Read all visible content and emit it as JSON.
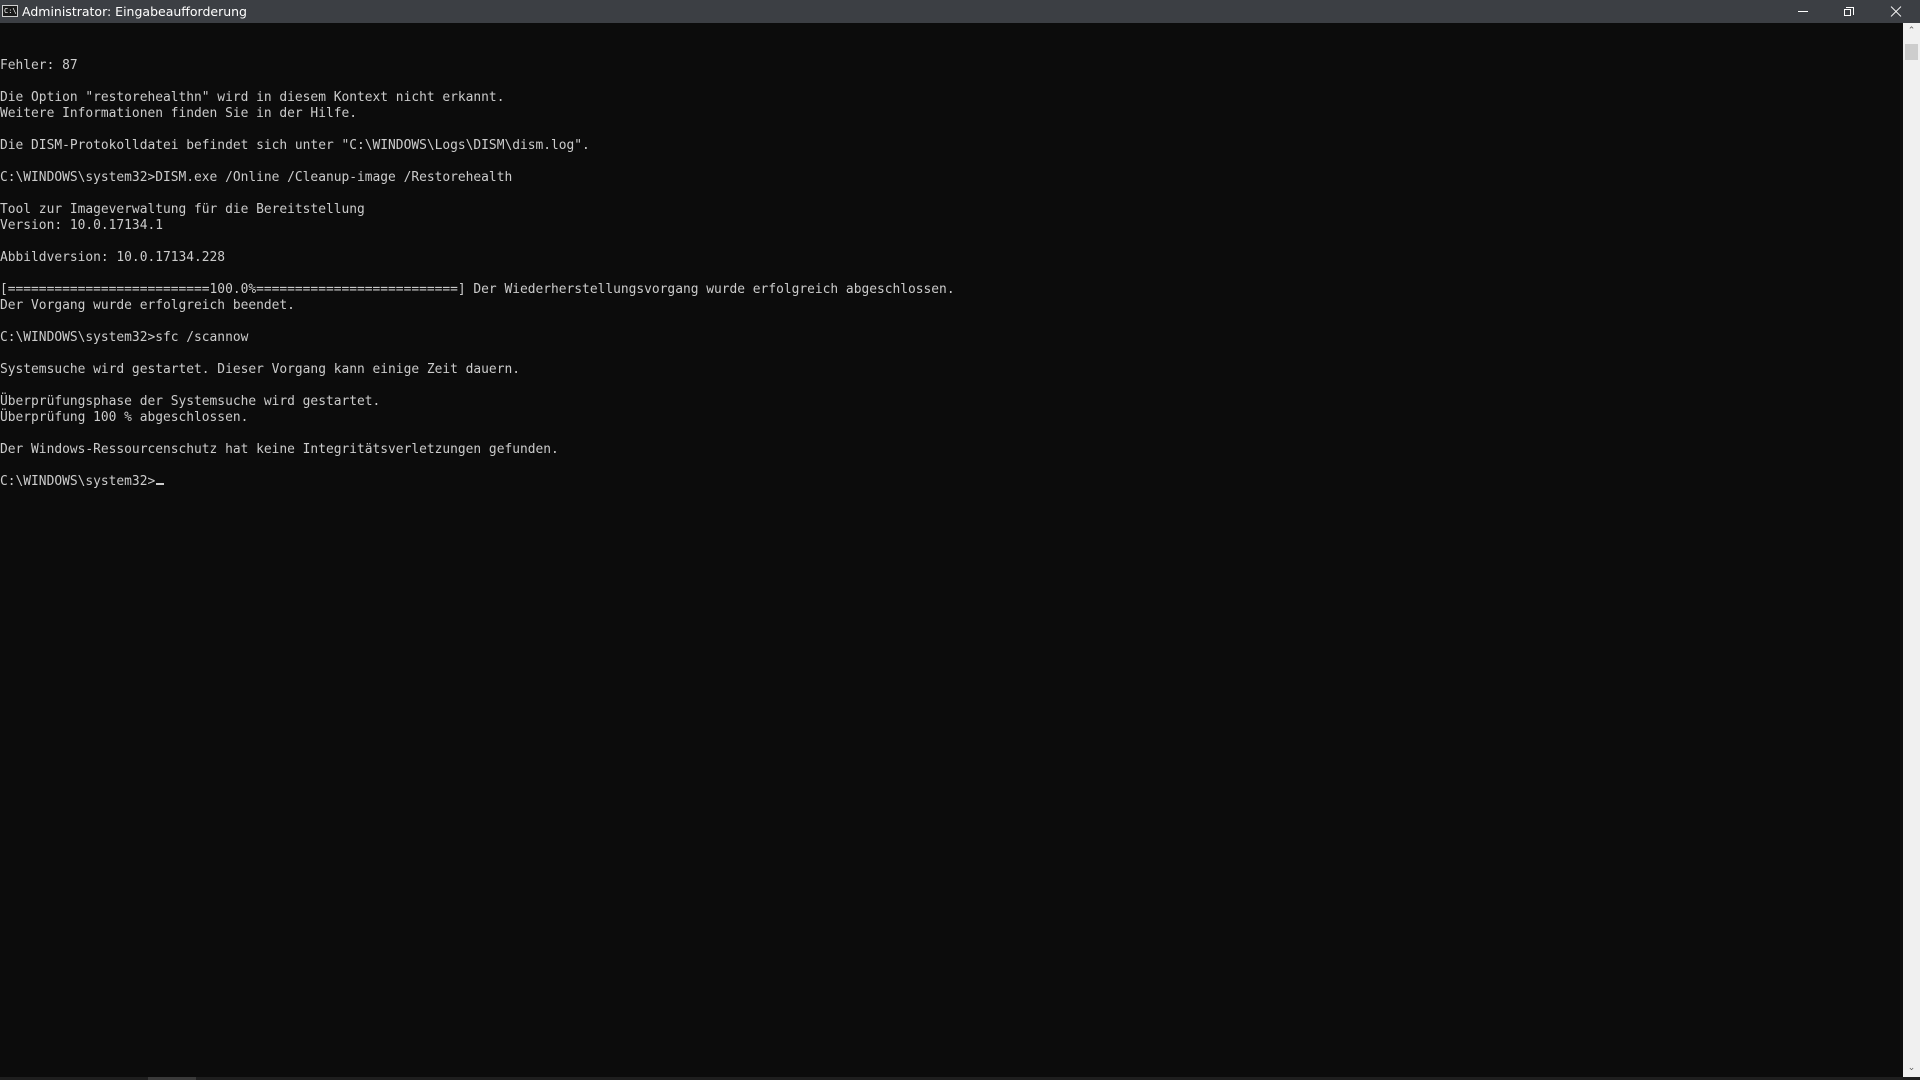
{
  "window": {
    "title": "Administrator: Eingabeaufforderung",
    "app_icon_text": "C:\\."
  },
  "controls": {
    "minimize": "minimize-icon",
    "maximize": "restore-icon",
    "close": "close-icon"
  },
  "console": {
    "lines": [
      "",
      "",
      "Fehler: 87",
      "",
      "Die Option \"restorehealthn\" wird in diesem Kontext nicht erkannt.",
      "Weitere Informationen finden Sie in der Hilfe.",
      "",
      "Die DISM-Protokolldatei befindet sich unter \"C:\\WINDOWS\\Logs\\DISM\\dism.log\".",
      "",
      "C:\\WINDOWS\\system32>DISM.exe /Online /Cleanup-image /Restorehealth",
      "",
      "Tool zur Imageverwaltung für die Bereitstellung",
      "Version: 10.0.17134.1",
      "",
      "Abbildversion: 10.0.17134.228",
      "",
      "[==========================100.0%==========================] Der Wiederherstellungsvorgang wurde erfolgreich abgeschlossen.",
      "Der Vorgang wurde erfolgreich beendet.",
      "",
      "C:\\WINDOWS\\system32>sfc /scannow",
      "",
      "Systemsuche wird gestartet. Dieser Vorgang kann einige Zeit dauern.",
      "",
      "Überprüfungsphase der Systemsuche wird gestartet.",
      "Überprüfung 100 % abgeschlossen.",
      "",
      "Der Windows-Ressourcenschutz hat keine Integritätsverletzungen gefunden.",
      "",
      "C:\\WINDOWS\\system32>"
    ],
    "text_color": "#cccccc",
    "background": "#0c0c0c"
  },
  "scrollbar": {
    "up_arrow": "⌃",
    "down_arrow": "⌄"
  }
}
